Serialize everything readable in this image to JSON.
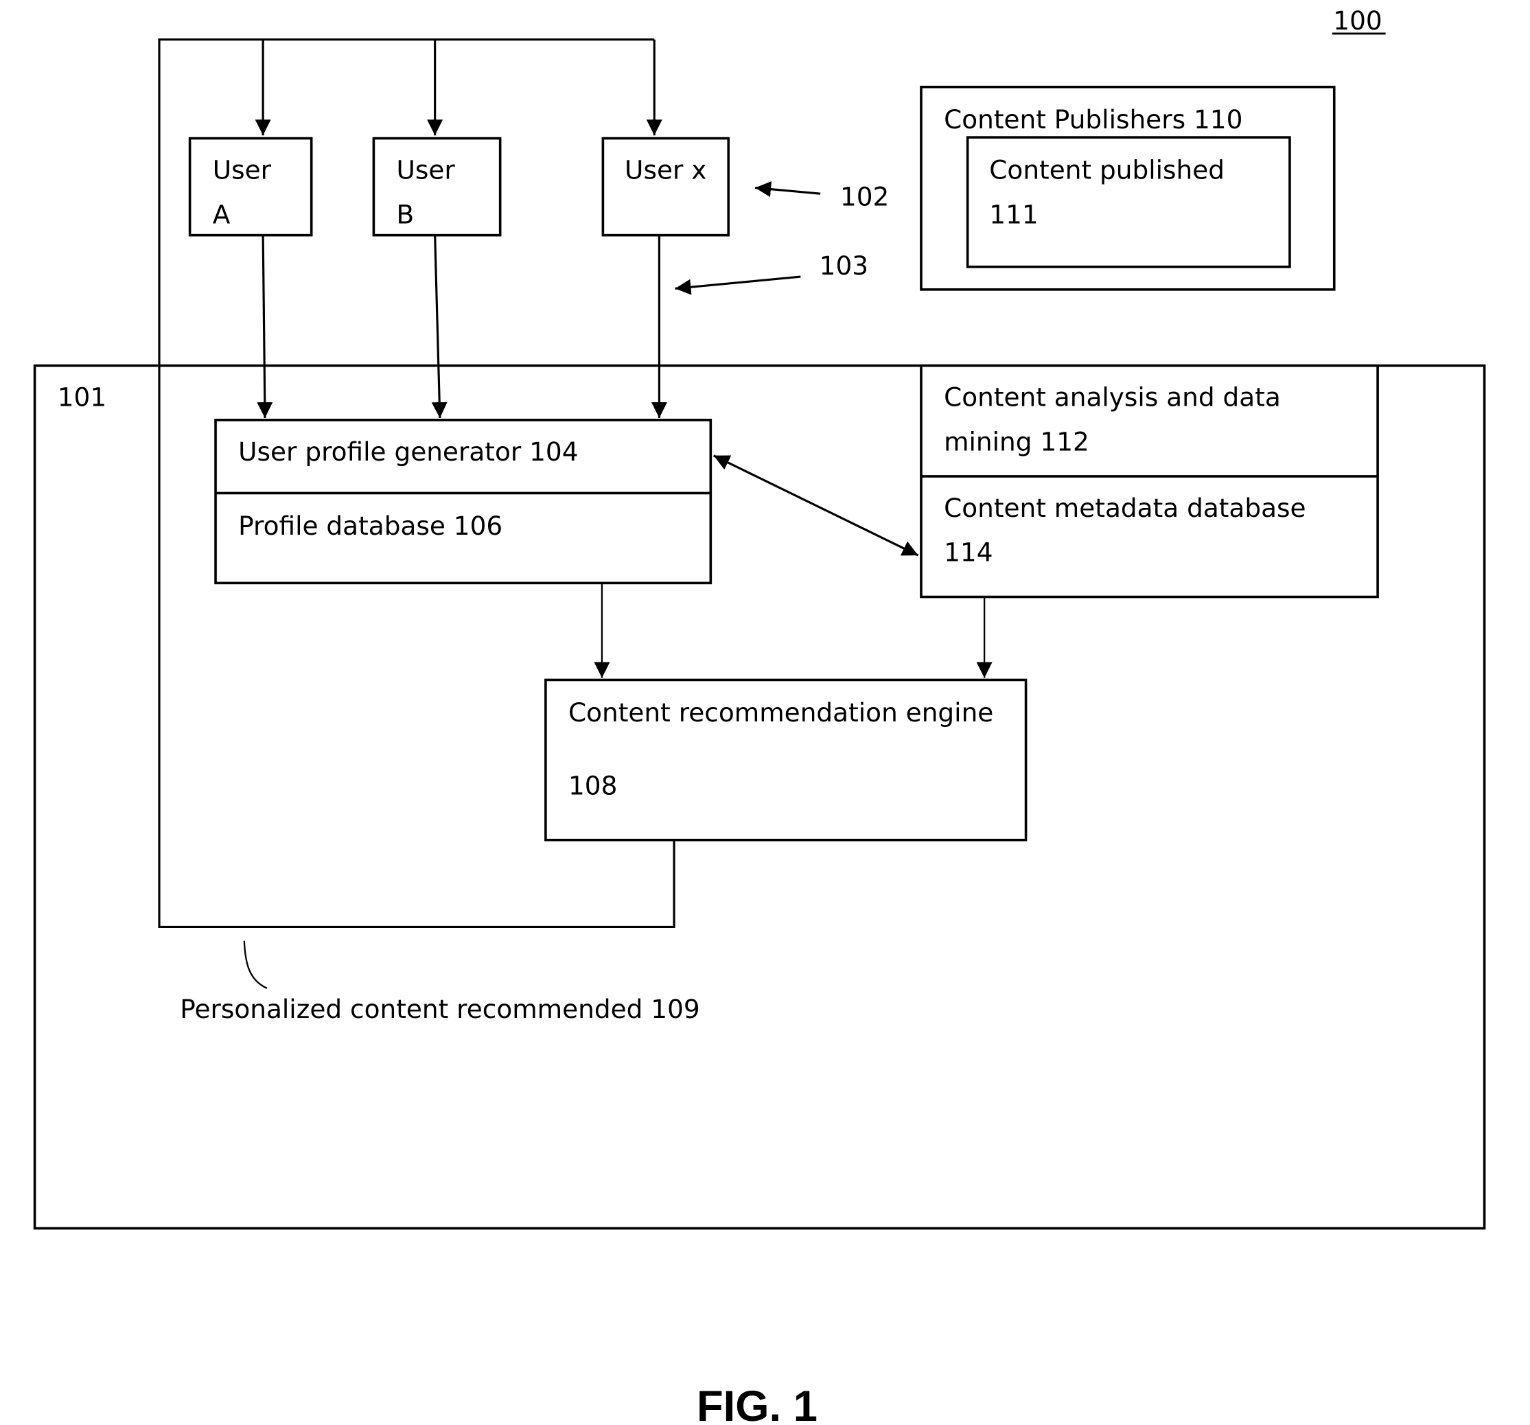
{
  "figure": {
    "ref": "100",
    "caption": "FIG. 1"
  },
  "users": [
    {
      "line1": "User",
      "line2": "A"
    },
    {
      "line1": "User",
      "line2": "B"
    },
    {
      "line1": "User x",
      "line2": ""
    }
  ],
  "refs": {
    "users_group": "102",
    "user_links": "103"
  },
  "publishers": {
    "title": "Content Publishers 110",
    "content_line1": "Content published",
    "content_line2": "111"
  },
  "system": {
    "ref": "101",
    "profile_generator": "User profile generator 104",
    "profile_database": "Profile database 106",
    "analysis_line1": "Content analysis and data",
    "analysis_line2": "mining 112",
    "metadata_line1": "Content metadata database",
    "metadata_line2": "114",
    "engine_line1": "Content recommendation engine",
    "engine_line2": "108",
    "recommended_label": "Personalized content recommended 109"
  }
}
